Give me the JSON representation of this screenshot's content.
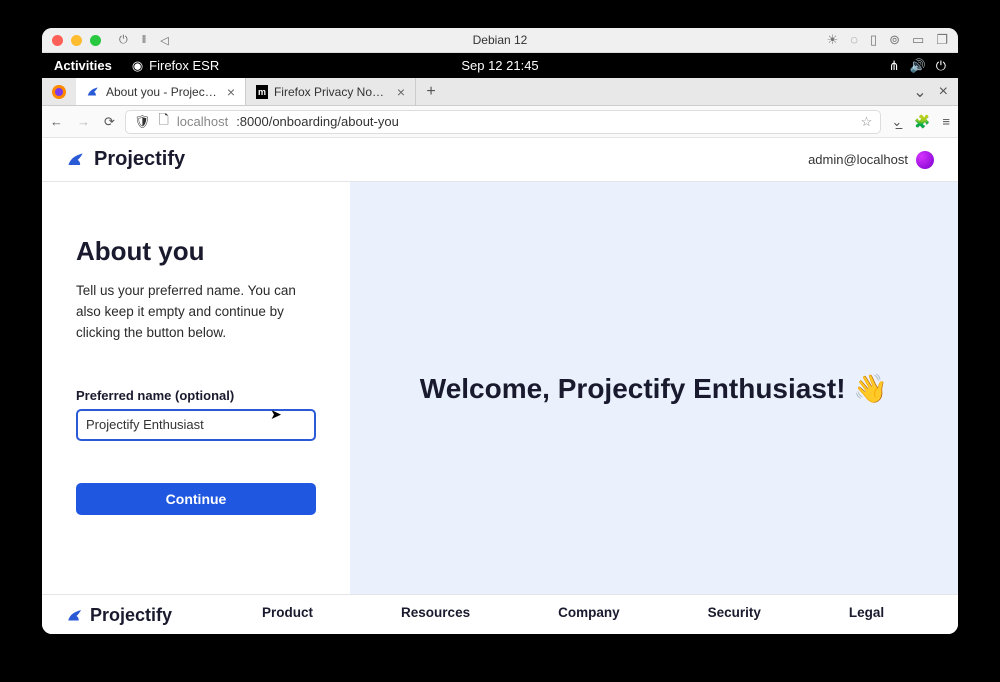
{
  "os_titlebar": {
    "distro": "Debian 12"
  },
  "gnome": {
    "activities": "Activities",
    "app": "Firefox ESR",
    "datetime": "Sep 12  21:45"
  },
  "tabs": [
    {
      "label": "About you - Projectify",
      "active": true
    },
    {
      "label": "Firefox Privacy Notice —",
      "active": false
    }
  ],
  "url": {
    "host": "localhost",
    "port_path": ":8000/onboarding/about-you"
  },
  "app": {
    "brand": "Projectify",
    "user_email": "admin@localhost"
  },
  "form": {
    "heading": "About you",
    "description": "Tell us your preferred name. You can also keep it empty and continue by clicking the button below.",
    "field_label": "Preferred name (optional)",
    "field_value": "Projectify Enthusiast",
    "submit_label": "Continue"
  },
  "welcome": {
    "text": "Welcome, Projectify Enthusiast! 👋"
  },
  "footer": {
    "brand": "Projectify",
    "links": [
      "Product",
      "Resources",
      "Company",
      "Security",
      "Legal"
    ]
  }
}
